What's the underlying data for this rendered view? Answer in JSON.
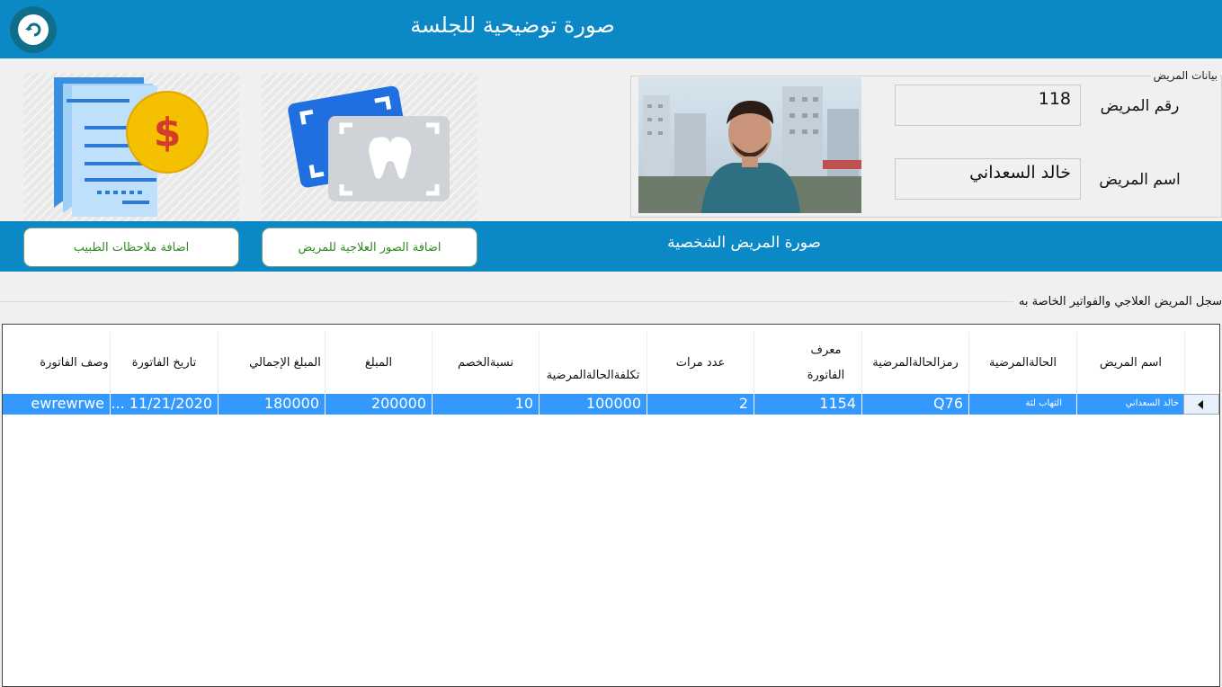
{
  "header": {
    "title": "صورة توضيحية للجلسة",
    "back_icon": "undo-arrow-icon"
  },
  "patient_info": {
    "legend": "بيانات المريض",
    "id_label": "رقم المريض",
    "id_value": "118",
    "name_label": "اسم المريض",
    "name_value": "خالد السعداني",
    "photo_caption": "صورة المريض الشخصية"
  },
  "actions": {
    "add_images": "اضافة الصور العلاجية للمريض",
    "add_notes": "اضافة ملاحظات الطبيب"
  },
  "records": {
    "title": "سجل المريض العلاجي والفواتير الخاصة به",
    "columns": [
      "اسم المريض",
      "الحالةالمرضية",
      "رمزالحالةالمرضية",
      "معرف الفاتورة",
      "عدد مرات",
      "تكلفةالحالةالمرضية",
      "نسبةالخصم",
      "المبلغ",
      "المبلغ الإجمالي",
      "تاريخ الفاتورة",
      "وصف الفاتورة"
    ],
    "rows": [
      [
        "خالد السعداني",
        "التهاب لثة",
        "Q76",
        "1154",
        "2",
        "100000",
        "10",
        "200000",
        "180000",
        "11/21/2020 ...",
        "ewrewrwe"
      ]
    ]
  },
  "colors": {
    "primary": "#0b88c6",
    "selection": "#3399ff",
    "button_text": "#2d8a1f",
    "tile_bg": "#e9e9e9"
  },
  "icons": {
    "images_tile": "dental-xray-icon",
    "notes_tile": "invoice-document-icon"
  }
}
